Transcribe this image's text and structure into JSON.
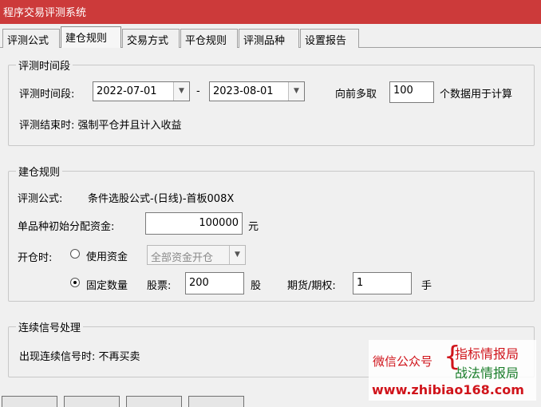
{
  "window": {
    "title": "程序交易评测系统"
  },
  "tabs": [
    {
      "label": "评测公式",
      "active": false
    },
    {
      "label": "建仓规则",
      "active": true
    },
    {
      "label": "交易方式",
      "active": false
    },
    {
      "label": "平仓规则",
      "active": false
    },
    {
      "label": "评测品种",
      "active": false
    },
    {
      "label": "设置报告",
      "active": false
    }
  ],
  "period": {
    "group_title": "评测时间段",
    "period_label": "评测时间段:",
    "start_date": "2022-07-01",
    "separator": "-",
    "end_date": "2023-08-01",
    "lookback_label": "向前多取",
    "lookback_value": "100",
    "lookback_suffix": "个数据用于计算",
    "end_rule": "评测结束时: 强制平仓并且计入收益"
  },
  "build": {
    "group_title": "建仓规则",
    "formula_label": "评测公式:",
    "formula_value": "条件选股公式-(日线)-首板008X",
    "capital_label": "单品种初始分配资金:",
    "capital_value": "100000",
    "capital_unit": "元",
    "open_label": "开仓时:",
    "use_capital_label": "使用资金",
    "use_capital_checked": false,
    "capital_mode": "全部资金开仓",
    "fixed_qty_label": "固定数量",
    "fixed_qty_checked": true,
    "stock_label": "股票:",
    "stock_value": "200",
    "stock_unit": "股",
    "futures_label": "期货/期权:",
    "futures_value": "1",
    "futures_unit": "手"
  },
  "signal": {
    "group_title": "连续信号处理",
    "rule": "出现连续信号时: 不再买卖"
  },
  "watermark": {
    "left": "微信公众号",
    "brace": "{",
    "top": "指标情报局",
    "bottom": "战法情报局",
    "url": "www.zhibiao168.com"
  },
  "colors": {
    "titlebar": "#cc3a3a",
    "watermark_red": "#d0141b",
    "watermark_green": "#1a7d2a"
  }
}
